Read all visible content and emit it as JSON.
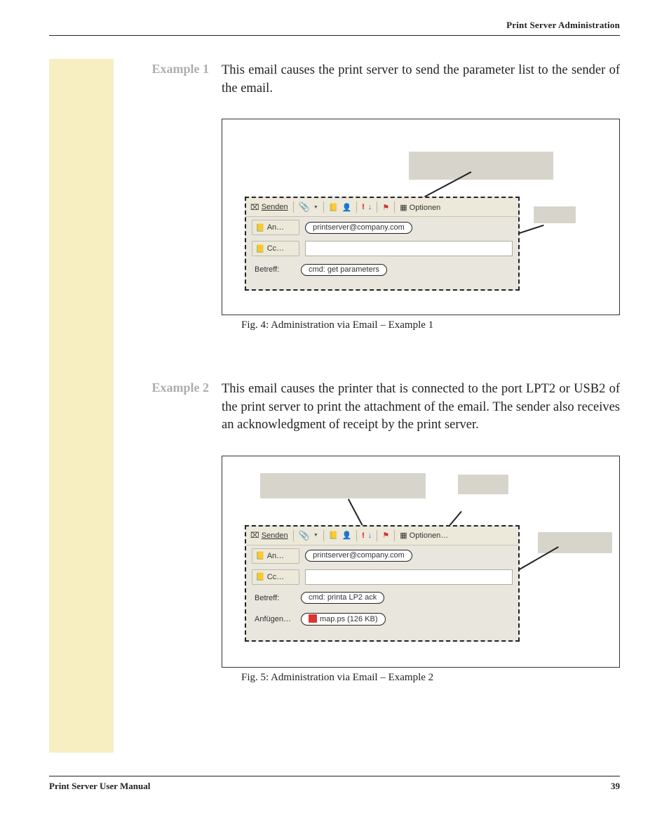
{
  "header": {
    "running": "Print Server Administration"
  },
  "example1": {
    "label": "Example 1",
    "text": "This email causes the print server to send the parameter list to the sender of the email.",
    "caption": "Fig. 4: Administration via Email – Example 1"
  },
  "example2": {
    "label": "Example 2",
    "text": "This email causes the printer that is connected to the port LPT2 or USB2 of the print server to print the attachment of the email. The sender also receives an acknowledgment of receipt by the print server.",
    "caption": "Fig. 5: Administration via Email – Example 2"
  },
  "email": {
    "send": "Senden",
    "options": "Optionen",
    "options2": "Optionen…",
    "an": "An…",
    "cc": "Cc…",
    "betreff": "Betreff:",
    "anfugen": "Anfügen…",
    "to": "printserver@company.com",
    "subject1": "cmd: get parameters",
    "subject2": "cmd: printa LP2 ack",
    "attachment": "map.ps (126 KB)"
  },
  "footer": {
    "left": "Print Server User Manual",
    "page": "39"
  }
}
